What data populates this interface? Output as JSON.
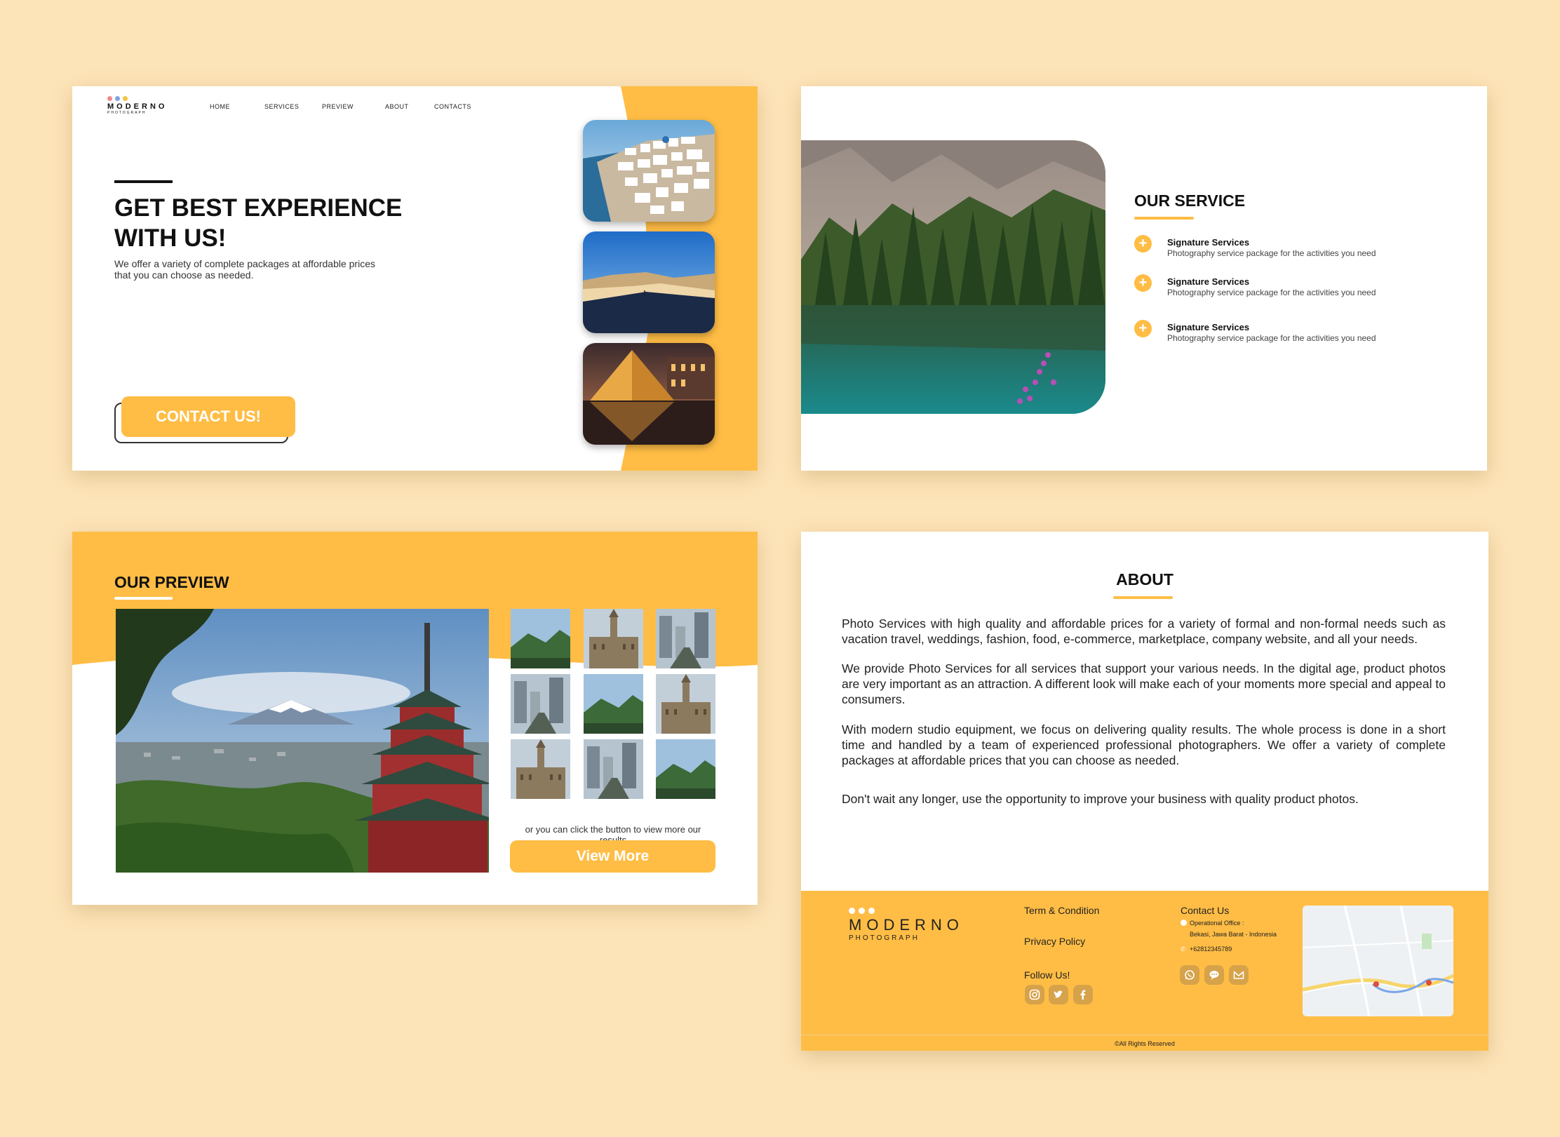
{
  "colors": {
    "accent": "#ffbd45",
    "background": "#fde4b8"
  },
  "logo": {
    "name": "MODERNO",
    "sub": "PHOTOGRAPH"
  },
  "nav": [
    "HOME",
    "SERVICES",
    "PREVIEW",
    "ABOUT",
    "CONTACTS"
  ],
  "hero": {
    "title_line1": "GET BEST EXPERIENCE",
    "title_line2": "WITH US!",
    "desc_line1": "We offer a variety of complete packages at affordable prices",
    "desc_line2": "that you can choose as needed.",
    "cta": "CONTACT US!"
  },
  "service": {
    "title": "OUR SERVICE",
    "items": [
      {
        "name": "Signature Services",
        "desc": "Photography service package for the activities you need"
      },
      {
        "name": "Signature Services",
        "desc": "Photography service package for the activities you need"
      },
      {
        "name": "Signature Services",
        "desc": "Photography service package for the activities you need"
      }
    ]
  },
  "preview": {
    "title": "OUR PREVIEW",
    "note": "or you can click the button to view more our results",
    "button": "View More"
  },
  "about": {
    "title": "ABOUT",
    "paragraphs": [
      "Photo Services with high quality and affordable prices for a variety of formal and non-formal needs such as vacation travel, weddings, fashion, food, e-commerce, marketplace, company website, and all your needs.",
      "We provide Photo Services for all services that support your various needs. In the digital age, product photos are very important as an attraction. A different look will make each of your moments more special and appeal to consumers.",
      "With modern studio equipment, we focus on delivering quality results. The whole process is done in a short time and handled by a team of experienced professional photographers. We offer a variety of complete packages at affordable prices that you can choose as needed.",
      "Don't wait any longer, use the opportunity to improve your business with quality product photos."
    ]
  },
  "footer": {
    "terms": "Term & Condition",
    "privacy": "Privacy Policy",
    "follow": "Follow Us!",
    "contact_title": "Contact Us",
    "office_label": "Operational Office :",
    "office_address": "Bekasi, Jawa Barat - Indonesia",
    "phone": "+62812345789",
    "copyright": "©All Rights Reserved",
    "social_left": [
      "instagram-icon",
      "twitter-icon",
      "facebook-icon"
    ],
    "social_right": [
      "whatsapp-icon",
      "chat-icon",
      "mail-icon"
    ]
  }
}
